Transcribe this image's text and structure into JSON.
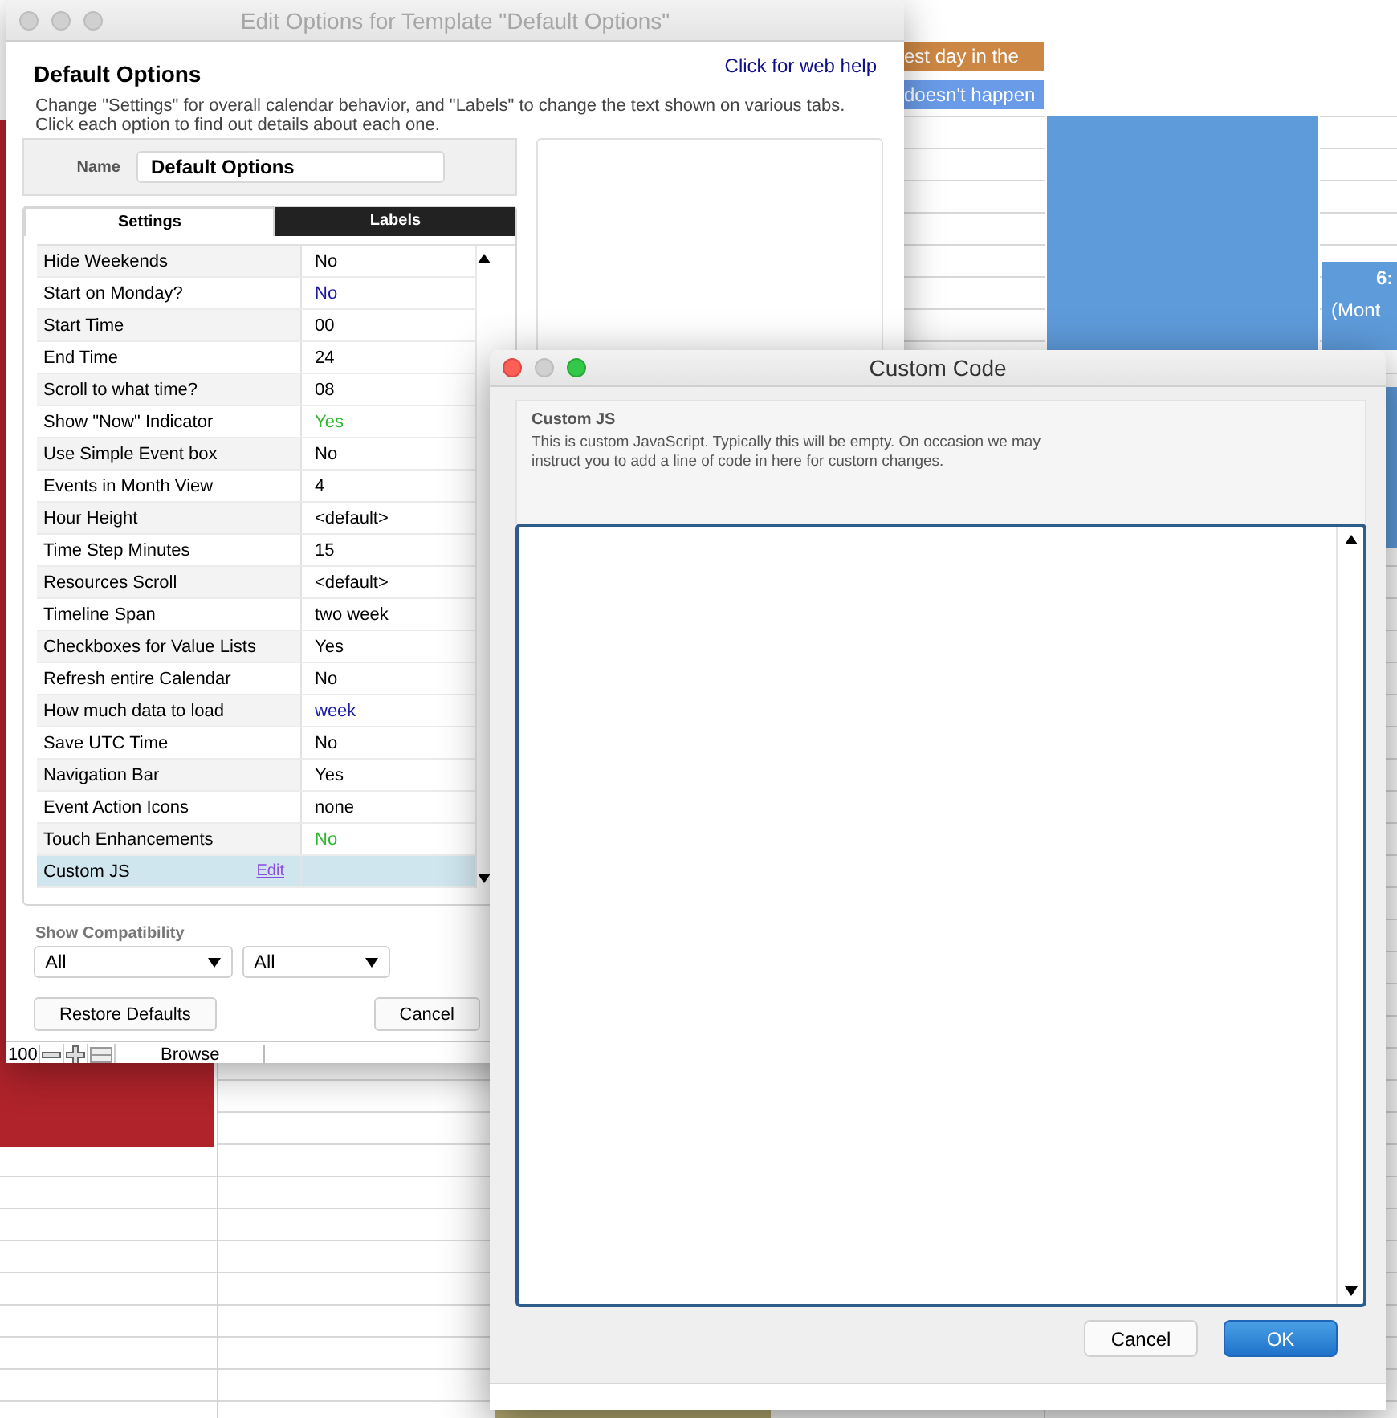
{
  "calendar": {
    "events": [
      {
        "text": "est day in the",
        "color": "#cd8744"
      },
      {
        "text": "doesn't happen",
        "color": "#6a9be8"
      }
    ],
    "side_event": {
      "time": "6:",
      "title": "(Mont"
    }
  },
  "options_window": {
    "title": "Edit Options for Template \"Default Options\"",
    "heading": "Default Options",
    "help_link": "Click for web help",
    "description": [
      "Change \"Settings\" for overall calendar behavior, and \"Labels\" to change the text shown on various tabs.",
      "Click each option to find out details about each one."
    ],
    "name_field": {
      "label": "Name",
      "value": "Default Options"
    },
    "tabs": [
      {
        "label": "Settings",
        "selected": true
      },
      {
        "label": "Labels",
        "selected": false
      }
    ],
    "settings": [
      {
        "label": "Hide Weekends",
        "value": "No",
        "color": "#000000",
        "selected": false
      },
      {
        "label": "Start on Monday?",
        "value": "No",
        "color": "#1a1aa6",
        "selected": false
      },
      {
        "label": "Start Time",
        "value": "00",
        "color": "#000000",
        "selected": false
      },
      {
        "label": "End Time",
        "value": "24",
        "color": "#000000",
        "selected": false
      },
      {
        "label": "Scroll to what time?",
        "value": "08",
        "color": "#000000",
        "selected": false
      },
      {
        "label": "Show \"Now\" Indicator",
        "value": "Yes",
        "color": "#2db82d",
        "selected": false
      },
      {
        "label": "Use Simple Event box",
        "value": "No",
        "color": "#000000",
        "selected": false
      },
      {
        "label": "Events in Month View",
        "value": "4",
        "color": "#000000",
        "selected": false
      },
      {
        "label": "Hour Height",
        "value": "<default>",
        "color": "#000000",
        "selected": false
      },
      {
        "label": "Time Step Minutes",
        "value": "15",
        "color": "#000000",
        "selected": false
      },
      {
        "label": "Resources Scroll",
        "value": "<default>",
        "color": "#000000",
        "selected": false
      },
      {
        "label": "Timeline Span",
        "value": "two week",
        "color": "#000000",
        "selected": false
      },
      {
        "label": "Checkboxes for Value Lists",
        "value": "Yes",
        "color": "#000000",
        "selected": false
      },
      {
        "label": "Refresh entire Calendar",
        "value": "No",
        "color": "#000000",
        "selected": false
      },
      {
        "label": "How much data to load",
        "value": "week",
        "color": "#1a1aa6",
        "selected": false
      },
      {
        "label": "Save UTC Time",
        "value": "No",
        "color": "#000000",
        "selected": false
      },
      {
        "label": "Navigation Bar",
        "value": "Yes",
        "color": "#000000",
        "selected": false
      },
      {
        "label": "Event Action Icons",
        "value": "none",
        "color": "#000000",
        "selected": false
      },
      {
        "label": "Touch Enhancements",
        "value": "No",
        "color": "#2db82d",
        "selected": false
      },
      {
        "label": "Custom JS",
        "link": "Edit",
        "selected": true
      }
    ],
    "compatibility": {
      "label": "Show Compatibility",
      "dropdowns": [
        "All",
        "All"
      ]
    },
    "buttons": [
      "Restore Defaults",
      "Cancel"
    ],
    "status_bar": {
      "zoom": "100",
      "mode": "Browse"
    }
  },
  "code_window": {
    "title": "Custom Code",
    "section": "Custom JS",
    "description": "This is custom JavaScript. Typically this will be empty. On occasion we may instruct you to add a line of code in here for custom changes.",
    "buttons": [
      {
        "label": "Cancel",
        "default": false
      },
      {
        "label": "OK",
        "default": true
      }
    ]
  }
}
